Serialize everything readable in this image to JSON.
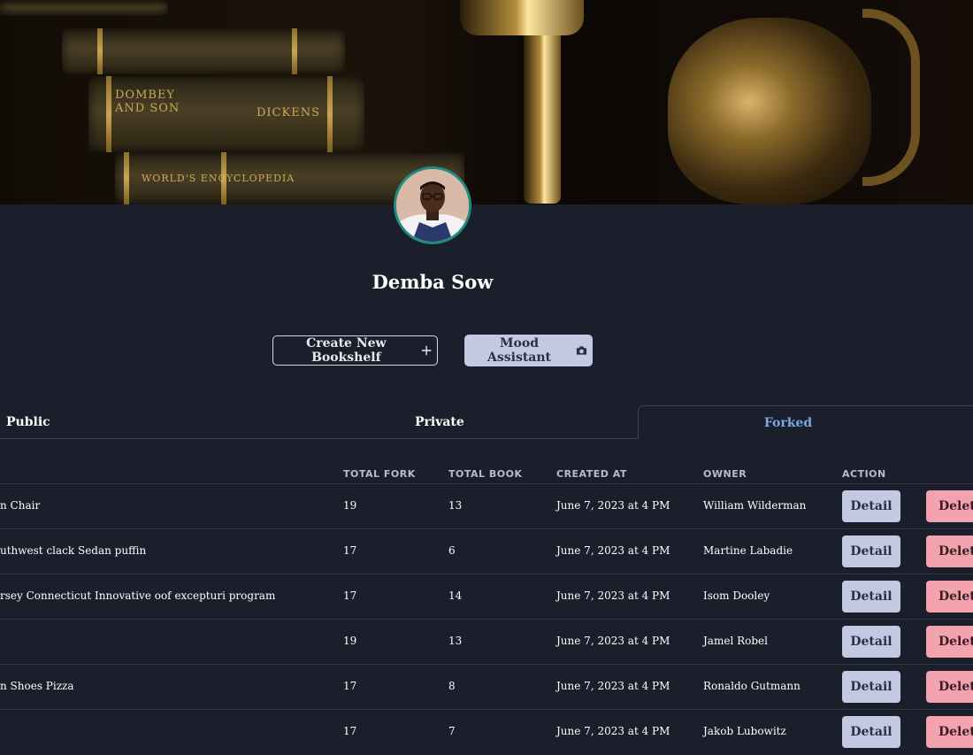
{
  "profile": {
    "name": "Demba Sow",
    "create_bookshelf_label": "Create New Bookshelf",
    "mood_assistant_label": "Mood Assistant"
  },
  "banner": {
    "book_titles": [
      "DOMBEY AND SON",
      "DICKENS",
      "WORLD'S ENCYCLOPEDIA"
    ]
  },
  "tabs": [
    {
      "label": "Public",
      "active": false
    },
    {
      "label": "Private",
      "active": false
    },
    {
      "label": "Forked",
      "active": true
    }
  ],
  "table": {
    "headers": {
      "total_fork": "TOTAL FORK",
      "total_book": "TOTAL BOOK",
      "created_at": "CREATED AT",
      "owner": "OWNER",
      "action": "ACTION"
    },
    "detail_label": "Detail",
    "delete_label": "Delete",
    "rows": [
      {
        "name": "n Chair",
        "total_fork": "19",
        "total_book": "13",
        "created_at": "June 7, 2023 at 4 PM",
        "owner": "William Wilderman"
      },
      {
        "name": "uthwest clack Sedan puffin",
        "total_fork": "17",
        "total_book": "6",
        "created_at": "June 7, 2023 at 4 PM",
        "owner": "Martine Labadie"
      },
      {
        "name": "rsey Connecticut Innovative oof excepturi program",
        "total_fork": "17",
        "total_book": "14",
        "created_at": "June 7, 2023 at 4 PM",
        "owner": "Isom Dooley"
      },
      {
        "name": "",
        "total_fork": "19",
        "total_book": "13",
        "created_at": "June 7, 2023 at 4 PM",
        "owner": "Jamel Robel"
      },
      {
        "name": "n Shoes Pizza",
        "total_fork": "17",
        "total_book": "8",
        "created_at": "June 7, 2023 at 4 PM",
        "owner": "Ronaldo Gutmann"
      },
      {
        "name": "",
        "total_fork": "17",
        "total_book": "7",
        "created_at": "June 7, 2023 at 4 PM",
        "owner": "Jakob Lubowitz"
      }
    ]
  },
  "colors": {
    "background": "#1b1f2c",
    "active_tab": "#7fa6e6",
    "detail_button": "#c3c8e3",
    "delete_button": "#f3a3ae",
    "avatar_ring": "#1e8c7e"
  },
  "icons": {
    "create_bookshelf": "plus-icon",
    "mood_assistant": "camera-icon"
  }
}
